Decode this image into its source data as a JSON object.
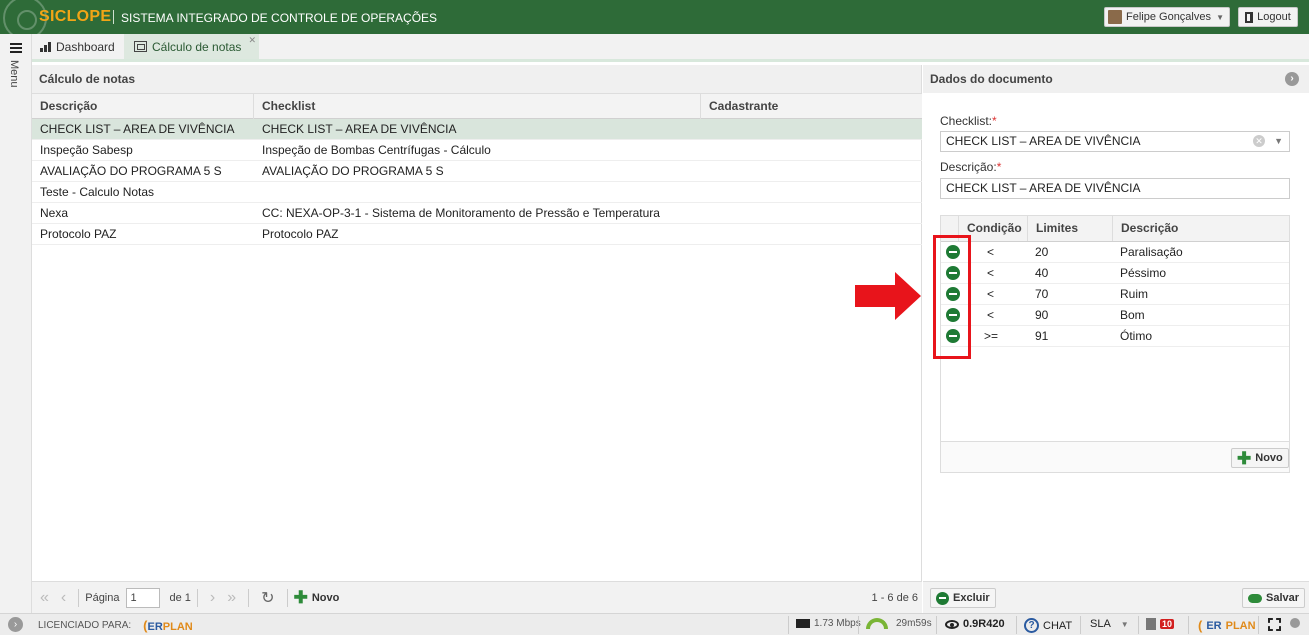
{
  "app": {
    "brand": "SICLOPE",
    "subtitle": "SISTEMA INTEGRADO DE CONTROLE DE OPERAÇÕES",
    "user_name": "Felipe Gonçalves",
    "logout_label": "Logout",
    "menu_label": "Menu",
    "brand_color": "#2e6b38",
    "accent_color": "#f2a516"
  },
  "tabs": [
    {
      "label": "Dashboard",
      "icon": "bar-chart-icon",
      "active": false
    },
    {
      "label": "Cálculo de notas",
      "icon": "calculator-icon",
      "active": true
    }
  ],
  "left_panel": {
    "title": "Cálculo de notas",
    "columns": [
      "Descrição",
      "Checklist",
      "Cadastrante"
    ],
    "rows": [
      {
        "descricao": "CHECK LIST – AREA DE VIVÊNCIA",
        "checklist": "CHECK LIST – AREA DE VIVÊNCIA",
        "cadastrante": "",
        "selected": true
      },
      {
        "descricao": "Inspeção Sabesp",
        "checklist": "Inspeção de Bombas Centrífugas - Cálculo",
        "cadastrante": "",
        "selected": false
      },
      {
        "descricao": "AVALIAÇÃO DO PROGRAMA 5 S",
        "checklist": "AVALIAÇÃO DO PROGRAMA 5 S",
        "cadastrante": "",
        "selected": false
      },
      {
        "descricao": "Teste - Calculo Notas",
        "checklist": "",
        "cadastrante": "",
        "selected": false
      },
      {
        "descricao": "Nexa",
        "checklist": "CC: NEXA-OP-3-1 - Sistema de Monitoramento de Pressão e Temperatura",
        "cadastrante": "",
        "selected": false
      },
      {
        "descricao": "Protocolo PAZ",
        "checklist": "Protocolo PAZ",
        "cadastrante": "",
        "selected": false
      }
    ],
    "pager": {
      "page_label": "Página",
      "page_value": "1",
      "of_label": "de 1",
      "novo_label": "Novo",
      "info": "1 - 6 de 6"
    }
  },
  "right_panel": {
    "title": "Dados do documento",
    "checklist_label": "Checklist:",
    "checklist_value": "CHECK LIST – AREA DE VIVÊNCIA",
    "descricao_label": "Descrição:",
    "descricao_value": "CHECK LIST – AREA DE VIVÊNCIA",
    "required_mark": "*",
    "limits_columns": [
      "Condição",
      "Limites",
      "Descrição"
    ],
    "limits": [
      {
        "condicao": "<",
        "limite": "20",
        "descricao": "Paralisação"
      },
      {
        "condicao": "<",
        "limite": "40",
        "descricao": "Péssimo"
      },
      {
        "condicao": "<",
        "limite": "70",
        "descricao": "Ruim"
      },
      {
        "condicao": "<",
        "limite": "90",
        "descricao": "Bom"
      },
      {
        "condicao": ">=",
        "limite": "91",
        "descricao": "Ótimo"
      }
    ],
    "novo_label": "Novo",
    "excluir_label": "Excluir",
    "salvar_label": "Salvar"
  },
  "annotation": {
    "highlight_color": "#e8141b"
  },
  "status_bar": {
    "licensed_label": "LICENCIADO PARA:",
    "erplan_er": "ER",
    "erplan_plan": "PLAN",
    "network": "1.73 Mbps",
    "session_time": "29m59s",
    "version": "0.9R420",
    "chat_label": "CHAT",
    "sla_label": "SLA",
    "notif_count": "10"
  }
}
